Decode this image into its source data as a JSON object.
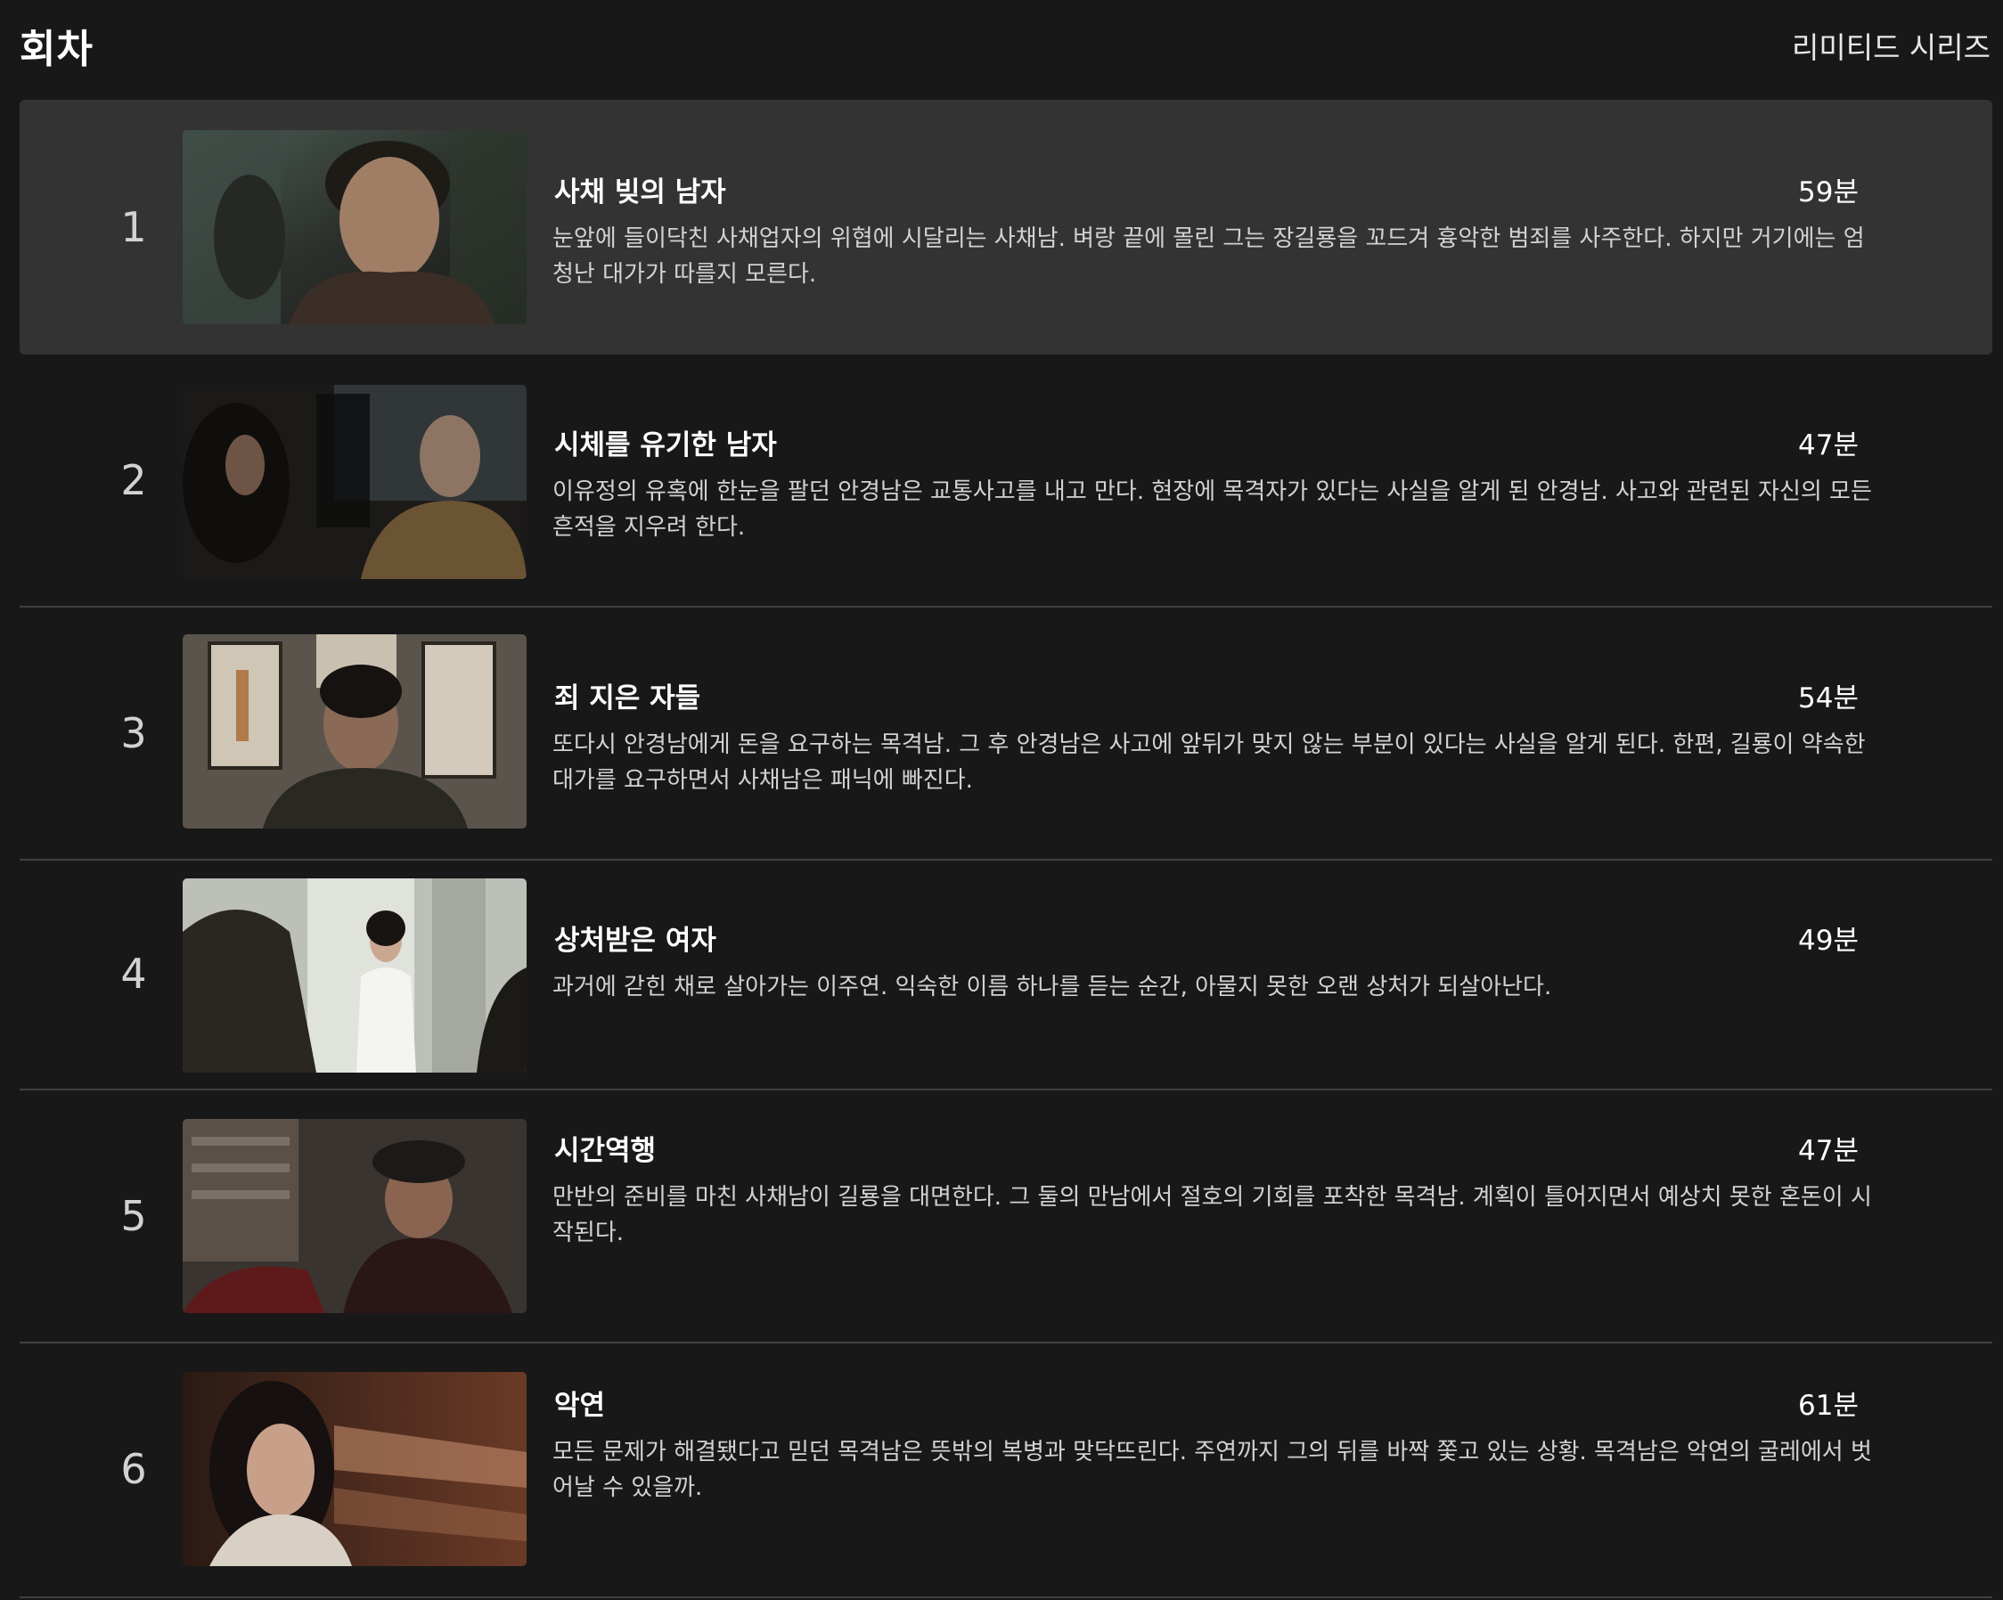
{
  "header": {
    "title": "회차",
    "series_type": "리미티드 시리즈"
  },
  "episodes": [
    {
      "number": "1",
      "title": "사채 빚의 남자",
      "duration": "59분",
      "synopsis": "눈앞에 들이닥친 사채업자의 위협에 시달리는 사채남. 벼랑 끝에 몰린 그는 장길룡을 꼬드겨 흉악한 범죄를 사주한다. 하지만 거기에는 엄청난 대가가 따를지 모른다."
    },
    {
      "number": "2",
      "title": "시체를 유기한 남자",
      "duration": "47분",
      "synopsis": "이유정의 유혹에 한눈을 팔던 안경남은 교통사고를 내고 만다. 현장에 목격자가 있다는 사실을 알게 된 안경남. 사고와 관련된 자신의 모든 흔적을 지우려 한다."
    },
    {
      "number": "3",
      "title": "죄 지은 자들",
      "duration": "54분",
      "synopsis": "또다시 안경남에게 돈을 요구하는 목격남. 그 후 안경남은 사고에 앞뒤가 맞지 않는 부분이 있다는 사실을 알게 된다. 한편, 길룡이 약속한 대가를 요구하면서 사채남은 패닉에 빠진다."
    },
    {
      "number": "4",
      "title": "상처받은 여자",
      "duration": "49분",
      "synopsis": "과거에 갇힌 채로 살아가는 이주연. 익숙한 이름 하나를 듣는 순간, 아물지 못한 오랜 상처가 되살아난다."
    },
    {
      "number": "5",
      "title": "시간역행",
      "duration": "47분",
      "synopsis": "만반의 준비를 마친 사채남이 길룡을 대면한다. 그 둘의 만남에서 절호의 기회를 포착한 목격남. 계획이 틀어지면서 예상치 못한 혼돈이 시작된다."
    },
    {
      "number": "6",
      "title": "악연",
      "duration": "61분",
      "synopsis": "모든 문제가 해결됐다고 믿던 목격남은 뜻밖의 복병과 맞닥뜨린다. 주연까지 그의 뒤를 바짝 쫓고 있는 상황. 목격남은 악연의 굴레에서 벗어날 수 있을까."
    }
  ]
}
